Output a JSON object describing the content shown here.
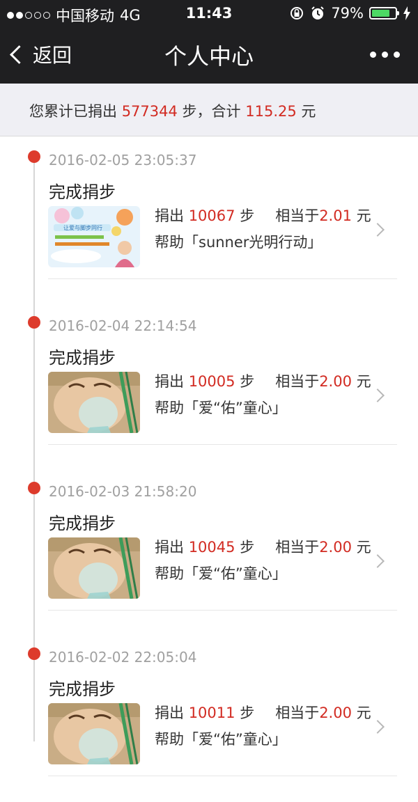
{
  "status_bar": {
    "carrier": "中国移动",
    "network": "4G",
    "time": "11:43",
    "battery": "79%",
    "battery_level": 0.79,
    "signal_bars_filled": 2,
    "signal_bars_total": 5
  },
  "nav": {
    "back_label": "返回",
    "title": "个人中心"
  },
  "summary": {
    "prefix": "您累计已捐出",
    "steps": "577344",
    "steps_unit": "步，合计",
    "amount": "115.25",
    "amount_unit": "元"
  },
  "colors": {
    "accent_red": "#d22b22",
    "dot_red": "#dd3b2c",
    "header_bg": "#1f1f21",
    "battery_green": "#4cd964"
  },
  "entries": [
    {
      "time": "2016-02-05 23:05:37",
      "status": "完成捐步",
      "donate_label": "捐出",
      "steps": "10067",
      "step_unit": "步",
      "equiv_label": "相当于",
      "amount": "2.01",
      "amount_unit": "元",
      "help_text": "帮助「sunner光明行动」",
      "thumb_icon": "sunner-campaign-image",
      "thumb_title": "让爱与脚步同行"
    },
    {
      "time": "2016-02-04 22:14:54",
      "status": "完成捐步",
      "donate_label": "捐出",
      "steps": "10005",
      "step_unit": "步",
      "equiv_label": "相当于",
      "amount": "2.00",
      "amount_unit": "元",
      "help_text": "帮助「爱“佑”童心」",
      "thumb_icon": "baby-oxygen-mask-image"
    },
    {
      "time": "2016-02-03 21:58:20",
      "status": "完成捐步",
      "donate_label": "捐出",
      "steps": "10045",
      "step_unit": "步",
      "equiv_label": "相当于",
      "amount": "2.00",
      "amount_unit": "元",
      "help_text": "帮助「爱“佑”童心」",
      "thumb_icon": "baby-oxygen-mask-image"
    },
    {
      "time": "2016-02-02 22:05:04",
      "status": "完成捐步",
      "donate_label": "捐出",
      "steps": "10011",
      "step_unit": "步",
      "equiv_label": "相当于",
      "amount": "2.00",
      "amount_unit": "元",
      "help_text": "帮助「爱“佑”童心」",
      "thumb_icon": "baby-oxygen-mask-image"
    }
  ]
}
